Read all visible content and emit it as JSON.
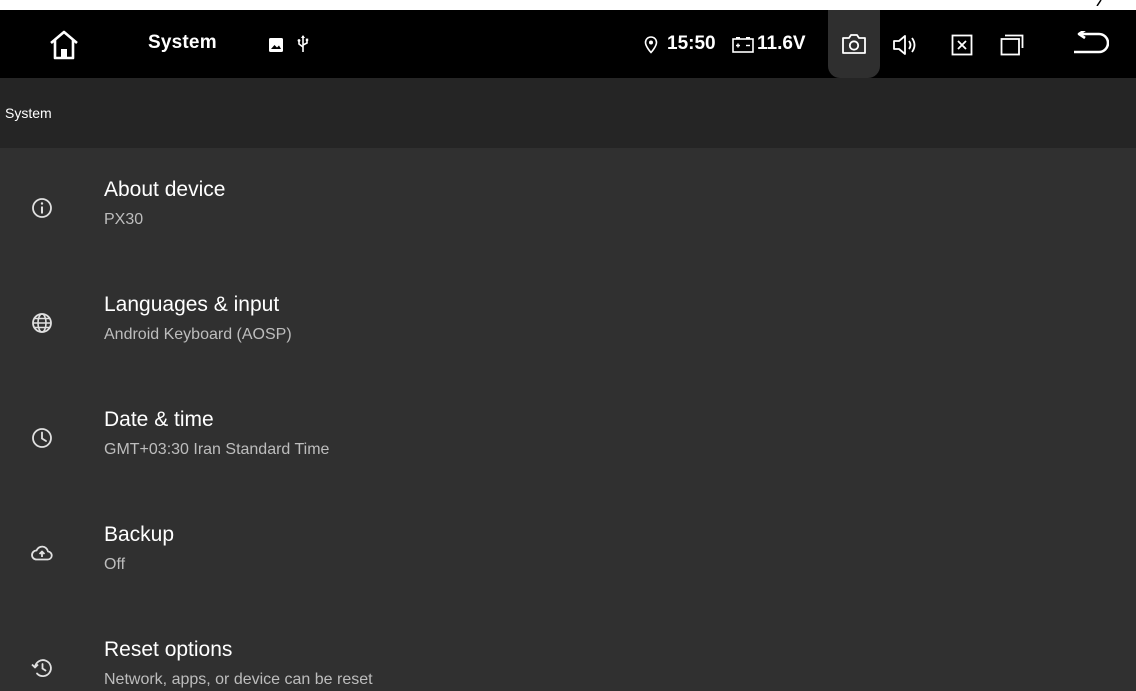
{
  "statusbar": {
    "title": "System",
    "time": "15:50",
    "voltage": "11.6V",
    "icons": {
      "home": "home-icon",
      "notif_image": "image-icon",
      "notif_usb": "usb-icon",
      "location": "location-icon",
      "battery": "car-battery-icon",
      "camera": "camera-icon",
      "volume": "volume-icon",
      "close": "close-window-icon",
      "recent": "recent-apps-icon",
      "back": "back-icon"
    }
  },
  "section": {
    "title": "System"
  },
  "items": [
    {
      "id": "about",
      "title": "About device",
      "subtitle": "PX30",
      "icon": "info-icon"
    },
    {
      "id": "languages",
      "title": "Languages & input",
      "subtitle": "Android Keyboard (AOSP)",
      "icon": "globe-icon"
    },
    {
      "id": "datetime",
      "title": "Date & time",
      "subtitle": "GMT+03:30 Iran Standard Time",
      "icon": "clock-icon"
    },
    {
      "id": "backup",
      "title": "Backup",
      "subtitle": "Off",
      "icon": "cloud-backup-icon"
    },
    {
      "id": "reset",
      "title": "Reset options",
      "subtitle": "Network, apps, or device can be reset",
      "icon": "restore-icon"
    }
  ],
  "colors": {
    "statusbar_bg": "#000000",
    "header_bg": "#252525",
    "list_bg": "#303030",
    "title_text": "#ffffff",
    "subtitle_text": "#bdbdbd"
  }
}
